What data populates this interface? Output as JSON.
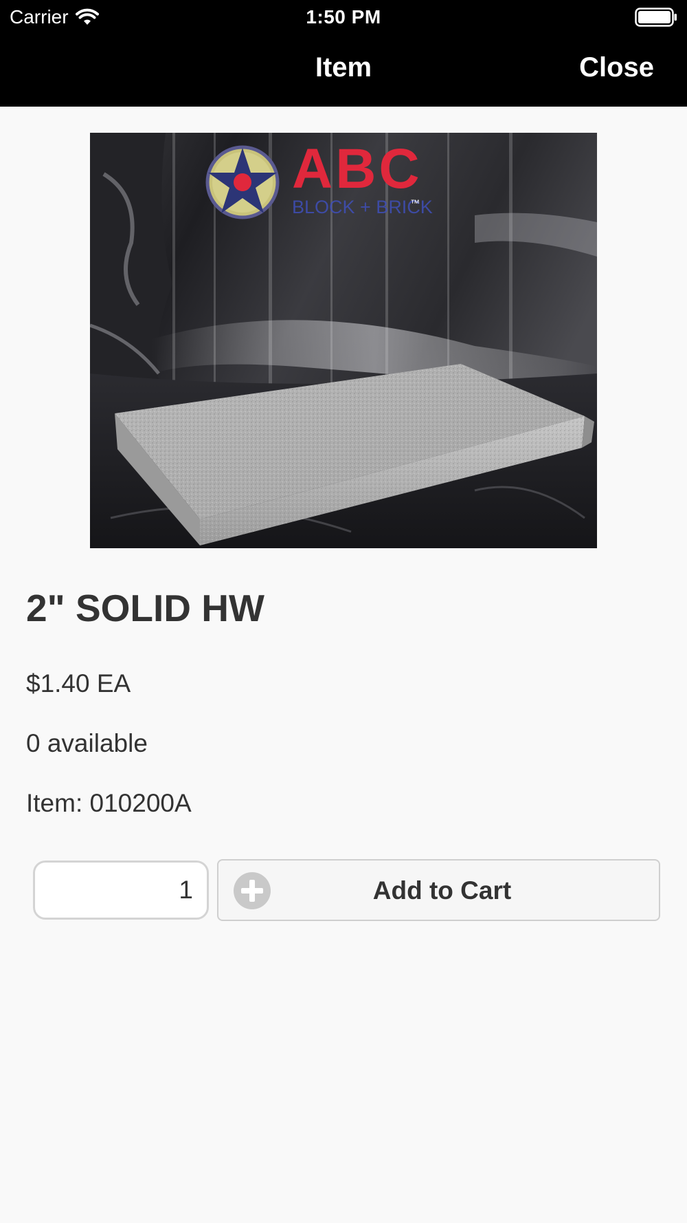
{
  "status_bar": {
    "carrier": "Carrier",
    "time": "1:50 PM",
    "icons": [
      "wifi-icon",
      "battery-icon"
    ]
  },
  "nav": {
    "title": "Item",
    "close_label": "Close"
  },
  "product": {
    "image": {
      "logo_text": "ABC",
      "logo_subtext": "BLOCK + BRICK",
      "logo_mark": "™"
    },
    "title": "2\" SOLID HW",
    "price": "$1.40 EA",
    "availability": "0 available",
    "item_number": "Item: 010200A"
  },
  "cart": {
    "quantity": "1",
    "add_label": "Add to Cart",
    "add_icon": "plus-circle-icon"
  },
  "colors": {
    "bar_background": "#000000",
    "page_background": "#f9f9f9",
    "text": "#333333",
    "logo_red": "#e0283c",
    "logo_blue": "#3f4fb8"
  }
}
